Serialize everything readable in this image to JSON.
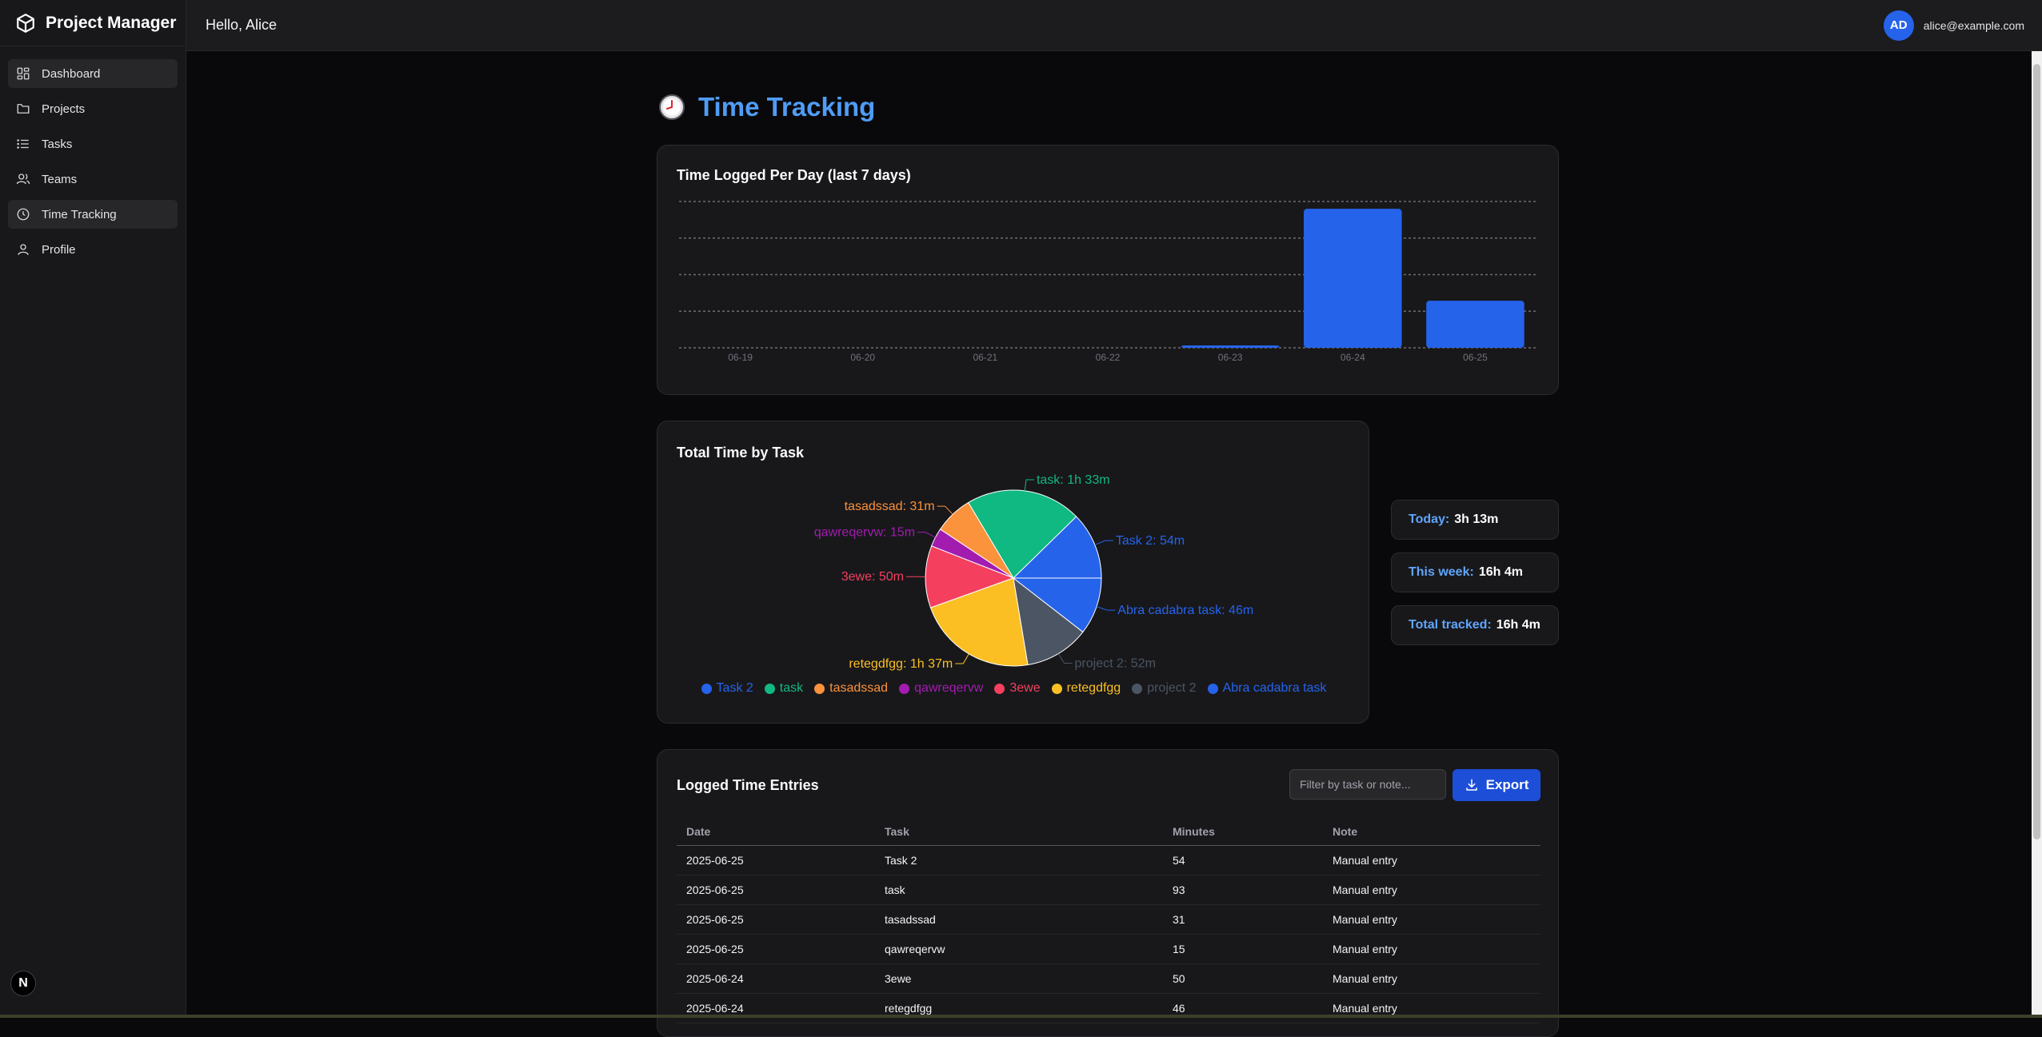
{
  "app": {
    "brand": "Project Manager"
  },
  "sidebar": {
    "items": [
      {
        "label": "Dashboard",
        "icon": "dashboard-icon",
        "active": true
      },
      {
        "label": "Projects",
        "icon": "folder-icon",
        "active": false
      },
      {
        "label": "Tasks",
        "icon": "list-icon",
        "active": false
      },
      {
        "label": "Teams",
        "icon": "users-icon",
        "active": false
      },
      {
        "label": "Time Tracking",
        "icon": "clock-icon",
        "active": true
      },
      {
        "label": "Profile",
        "icon": "user-icon",
        "active": false
      }
    ],
    "footer_badge": "N"
  },
  "header": {
    "greeting": "Hello, Alice",
    "avatar_initials": "AD",
    "email": "alice@example.com"
  },
  "page": {
    "title": "Time Tracking",
    "icon": "clock-emoji-icon"
  },
  "bar_card": {
    "title": "Time Logged Per Day (last 7 days)"
  },
  "pie_card": {
    "title": "Total Time by Task"
  },
  "stats": {
    "today_label": "Today:",
    "today_value": "3h 13m",
    "week_label": "This week:",
    "week_value": "16h 4m",
    "total_label": "Total tracked:",
    "total_value": "16h 4m"
  },
  "entries": {
    "title": "Logged Time Entries",
    "filter_placeholder": "Filter by task or note...",
    "export_label": "Export",
    "columns": [
      "Date",
      "Task",
      "Minutes",
      "Note"
    ],
    "rows": [
      [
        "2025-06-25",
        "Task 2",
        "54",
        "Manual entry"
      ],
      [
        "2025-06-25",
        "task",
        "93",
        "Manual entry"
      ],
      [
        "2025-06-25",
        "tasadssad",
        "31",
        "Manual entry"
      ],
      [
        "2025-06-25",
        "qawreqervw",
        "15",
        "Manual entry"
      ],
      [
        "2025-06-24",
        "3ewe",
        "50",
        "Manual entry"
      ],
      [
        "2025-06-24",
        "retegdfgg",
        "46",
        "Manual entry"
      ]
    ]
  },
  "colors": {
    "accent": "#2563eb",
    "title_blue": "#4f9cf5",
    "bg": "#09090b",
    "card": "#18181b"
  },
  "chart_data": [
    {
      "type": "bar",
      "title": "Time Logged Per Day (last 7 days)",
      "categories": [
        "06-19",
        "06-20",
        "06-21",
        "06-22",
        "06-23",
        "06-24",
        "06-25"
      ],
      "values": [
        0,
        0,
        0,
        0,
        10,
        570,
        193
      ],
      "ylim": [
        0,
        600
      ],
      "grid": true,
      "color": "#2563eb"
    },
    {
      "type": "pie",
      "title": "Total Time by Task",
      "slices": [
        {
          "name": "Task 2",
          "value": 54,
          "label": "Task 2: 54m",
          "color": "#2563eb"
        },
        {
          "name": "task",
          "value": 93,
          "label": "task: 1h 33m",
          "color": "#10b981"
        },
        {
          "name": "tasadssad",
          "value": 31,
          "label": "tasadssad: 31m",
          "color": "#fb923c"
        },
        {
          "name": "qawreqervw",
          "value": 15,
          "label": "qawreqervw: 15m",
          "color": "#a21caf"
        },
        {
          "name": "3ewe",
          "value": 50,
          "label": "3ewe: 50m",
          "color": "#f43f5e"
        },
        {
          "name": "retegdfgg",
          "value": 97,
          "label": "retegdfgg: 1h 37m",
          "color": "#fbbf24"
        },
        {
          "name": "project 2",
          "value": 52,
          "label": "project 2: 52m",
          "color": "#4b5563"
        },
        {
          "name": "Abra cadabra task",
          "value": 46,
          "label": "Abra cadabra task: 46m",
          "color": "#2563eb"
        }
      ],
      "legend": "bottom"
    }
  ]
}
